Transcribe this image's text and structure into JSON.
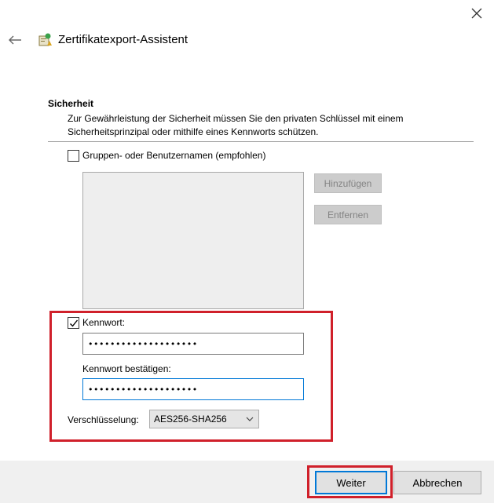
{
  "window": {
    "title": "Zertifikatexport-Assistent",
    "icons": {
      "close": "close-icon",
      "back": "back-arrow-icon",
      "app": "certificate-wizard-icon"
    }
  },
  "section": {
    "title": "Sicherheit",
    "description": "Zur Gewährleistung der Sicherheit müssen Sie den privaten Schlüssel mit einem Sicherheitsprinzipal oder mithilfe eines Kennworts schützen."
  },
  "principals": {
    "checkbox_label": "Gruppen- oder Benutzernamen (empfohlen)",
    "checked": false,
    "add_label": "Hinzufügen",
    "remove_label": "Entfernen"
  },
  "password": {
    "checkbox_label": "Kennwort:",
    "checked": true,
    "value_masked": "••••••••••••••••••••",
    "confirm_label": "Kennwort bestätigen:",
    "confirm_masked": "••••••••••••••••••••"
  },
  "encryption": {
    "label": "Verschlüsselung:",
    "selected": "AES256-SHA256"
  },
  "footer": {
    "next_label": "Weiter",
    "cancel_label": "Abbrechen"
  },
  "colors": {
    "highlight": "#d0202a",
    "focus": "#0078d7",
    "footer_bg": "#f0f0f0"
  }
}
